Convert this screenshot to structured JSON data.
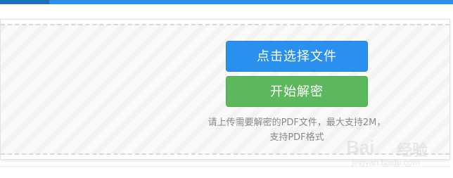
{
  "upload": {
    "select_button_label": "点击选择文件",
    "decrypt_button_label": "开始解密",
    "hint_line1": "请上传需要解密的PDF文件，最大支持2M，",
    "hint_line2": "支持PDF格式"
  },
  "colors": {
    "primary_blue": "#2a90ef",
    "success_green": "#5cb85c",
    "hint_gray": "#888888"
  },
  "watermark": {
    "brand": "Bai",
    "brand_cn": "经验",
    "url": "jingyan.baidu.com"
  }
}
